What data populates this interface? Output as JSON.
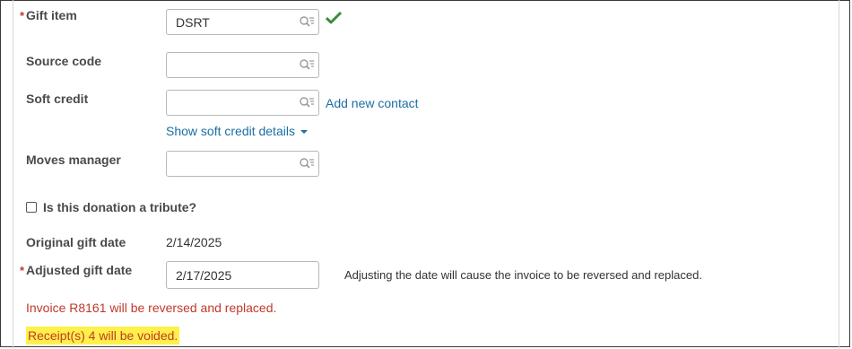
{
  "form": {
    "gift_item": {
      "label": "Gift item",
      "value": "DSRT",
      "required": true,
      "validated": true
    },
    "source_code": {
      "label": "Source code",
      "value": ""
    },
    "soft_credit": {
      "label": "Soft credit",
      "value": "",
      "add_link": "Add new contact"
    },
    "soft_credit_details_link": "Show soft credit details",
    "moves_manager": {
      "label": "Moves manager",
      "value": ""
    },
    "tribute_checkbox": {
      "label": "Is this donation a tribute?",
      "checked": false
    },
    "original_gift_date": {
      "label": "Original gift date",
      "value": "2/14/2025"
    },
    "adjusted_gift_date": {
      "label": "Adjusted gift date",
      "value": "2/17/2025",
      "required": true,
      "note": "Adjusting the date will cause the invoice to be reversed and replaced."
    }
  },
  "messages": {
    "invoice_warning": "Invoice R8161 will be reversed and replaced.",
    "receipt_warning": "Receipt(s) 4 will be voided."
  },
  "colors": {
    "required_asterisk": "#c0392b",
    "link": "#1a6fa3",
    "warning_text": "#c0392b",
    "highlight": "#fff04a",
    "check": "#3c8a3c"
  },
  "icons": {
    "lookup": "search-list-icon",
    "validated": "checkmark-icon",
    "dropdown": "caret-down-icon"
  }
}
